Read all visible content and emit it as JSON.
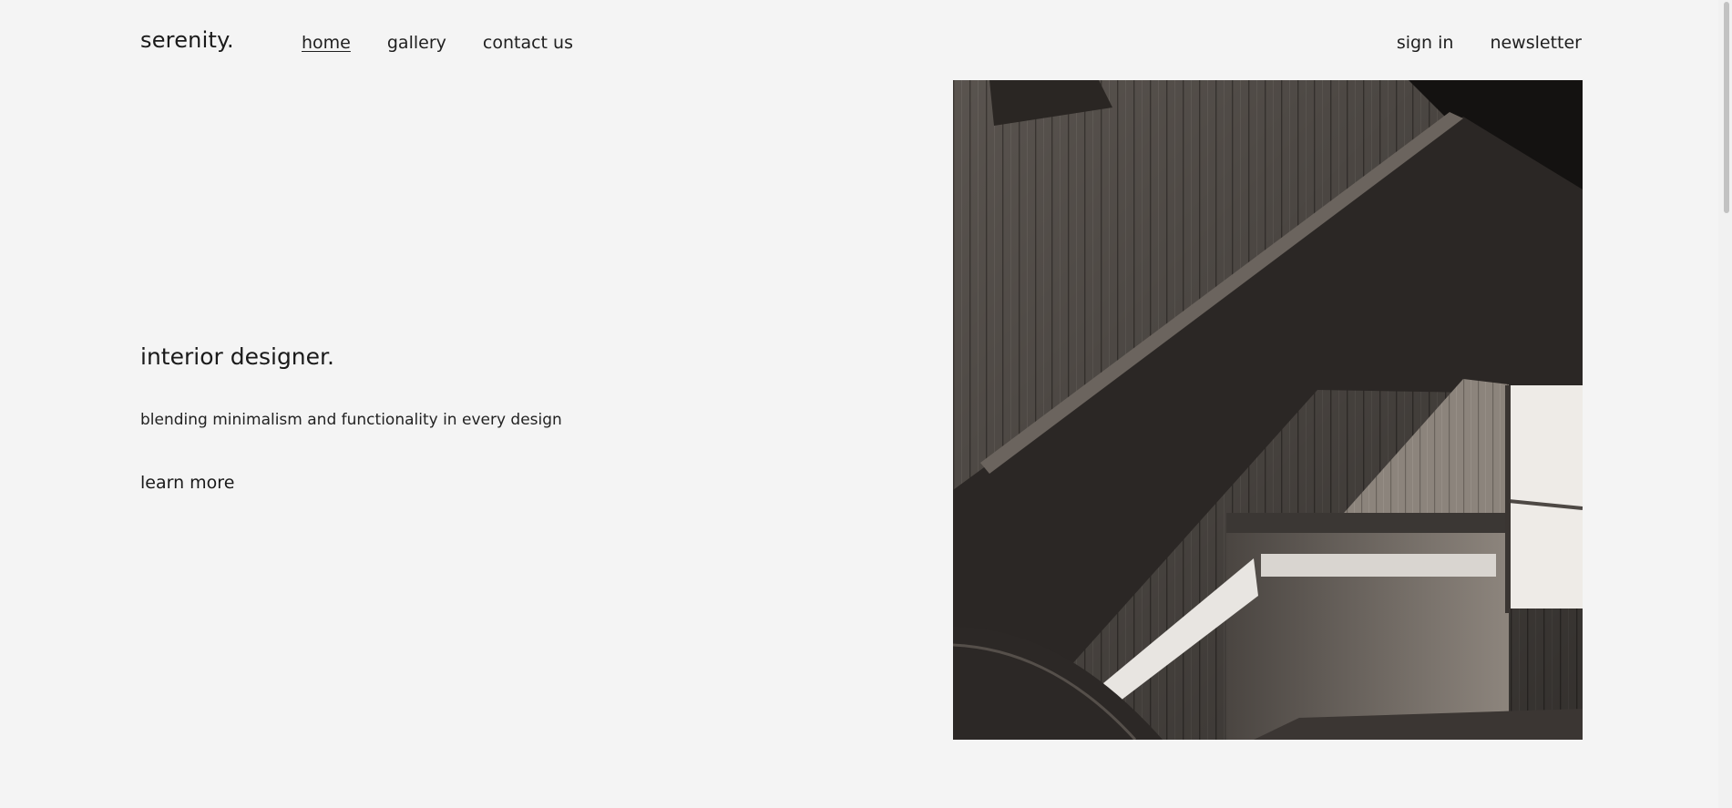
{
  "brand": {
    "logo": "serenity."
  },
  "nav": {
    "left": [
      {
        "label": "home",
        "active": true
      },
      {
        "label": "gallery",
        "active": false
      },
      {
        "label": "contact us",
        "active": false
      }
    ],
    "right": [
      {
        "label": "sign in"
      },
      {
        "label": "newsletter"
      }
    ]
  },
  "hero": {
    "title": "interior designer.",
    "subtitle": "blending minimalism and functionality in every design",
    "cta": "learn more",
    "image_icon": "staircase-photo"
  },
  "colors": {
    "background": "#f4f4f4",
    "text": "#1a1a1a"
  }
}
